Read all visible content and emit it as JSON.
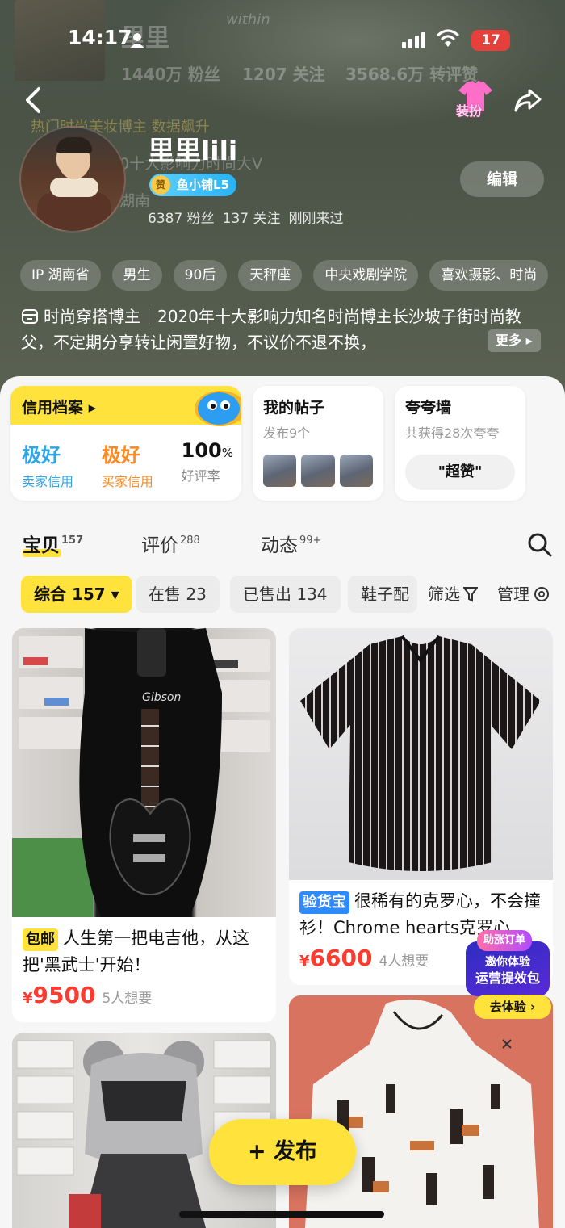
{
  "status_bar": {
    "time": "14:17",
    "battery": "17"
  },
  "background_ghost": {
    "name": "里里",
    "followers": "1440万 粉丝",
    "following": "1207 关注",
    "reposts": "3568.6万 转评赞",
    "hot_tag": "热门时尚美妆博主 数据飙升",
    "desc": "0十大影响力时尚大V",
    "location": "湖南",
    "logo": "within"
  },
  "header": {
    "dress_up_label": "装扮"
  },
  "profile": {
    "username": "里里lili",
    "level_badge_icon": "赞",
    "level_badge": "鱼小铺L5",
    "followers": "6387 粉丝",
    "following": "137 关注",
    "last_seen": "刚刚来过",
    "edit_label": "编辑"
  },
  "tags": [
    "IP 湖南省",
    "男生",
    "90后",
    "天秤座",
    "中央戏剧学院",
    "喜欢摄影、时尚"
  ],
  "bio": {
    "role": "时尚穿搭博主",
    "text": "2020年十大影响力知名时尚博主长沙坡子街时尚教父，不定期分享转让闲置好物，不议价不退不换，",
    "more_label": "更多"
  },
  "credit_card": {
    "title": "信用档案",
    "items": [
      {
        "value": "极好",
        "label": "卖家信用",
        "color": "#2ea7e8"
      },
      {
        "value": "极好",
        "label": "买家信用",
        "color": "#ff8a1f"
      },
      {
        "value": "100",
        "unit": "%",
        "label": "好评率",
        "color": "#111111"
      }
    ]
  },
  "posts_card": {
    "title": "我的帖子",
    "subtitle": "发布9个"
  },
  "praise_card": {
    "title": "夸夸墙",
    "subtitle": "共获得28次夸夸",
    "button": "\"超赞\""
  },
  "tabs": [
    {
      "label": "宝贝",
      "count": "157"
    },
    {
      "label": "评价",
      "count": "288"
    },
    {
      "label": "动态",
      "count": "99+"
    }
  ],
  "filters": {
    "chips": [
      "综合 157",
      "在售 23",
      "已售出 134",
      "鞋子配"
    ],
    "filter_label": "筛选",
    "manage_label": "管理"
  },
  "items": [
    {
      "badge": "包邮",
      "title": "人生第一把电吉他，从这把'黑武士'开始！",
      "currency": "¥",
      "price": "9500",
      "wants": "5人想要"
    },
    {
      "badge": "验货宝",
      "title": "很稀有的克罗心，不会撞衫！Chrome hearts克罗心",
      "currency": "¥",
      "price": "6600",
      "wants": "4人想要"
    }
  ],
  "guitar_brand": "Gibson",
  "promo": {
    "tag": "助涨订单",
    "line1": "邀你体验",
    "line2": "运营提效包",
    "cta": "去体验"
  },
  "publish_label": "+ 发布",
  "colors": {
    "accent": "#ffe33c",
    "price": "#ff3b30",
    "link_blue": "#2ea7e8"
  }
}
